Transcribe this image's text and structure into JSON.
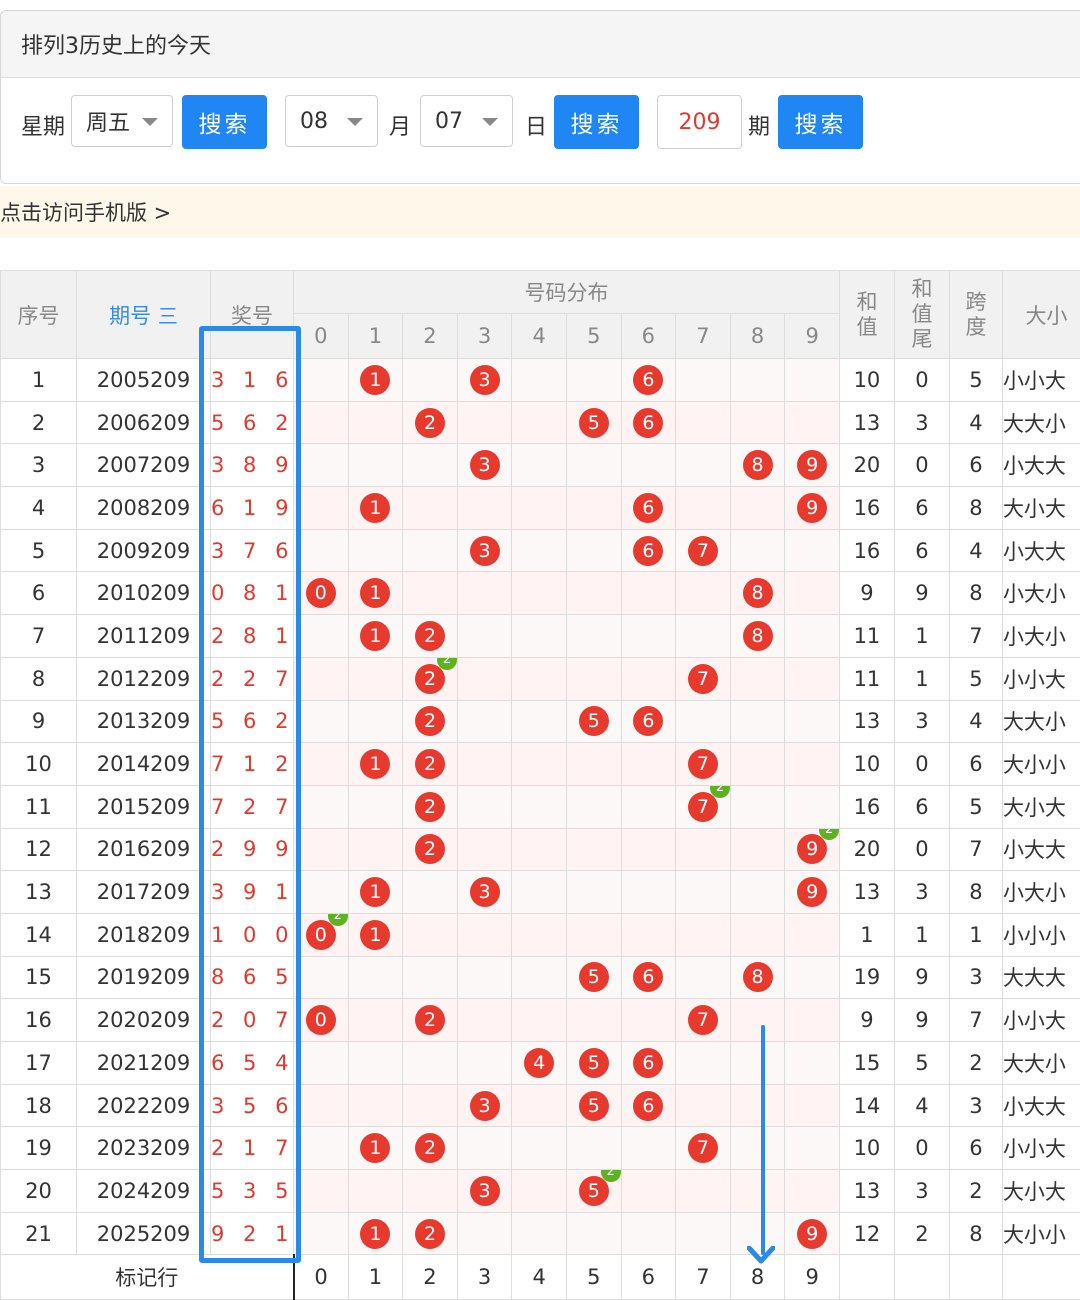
{
  "panel": {
    "title": "排列3历史上的今天",
    "weekday_label": "星期",
    "weekday_value": "周五",
    "search_label": "搜索",
    "month_value": "08",
    "month_label": "月",
    "day_value": "07",
    "day_label": "日",
    "period_value": "209",
    "period_label": "期"
  },
  "mobile_link": "点击访问手机版 >",
  "table": {
    "headers": {
      "index": "序号",
      "period": "期号",
      "period_sort_icon": "三",
      "prize": "奖号",
      "distribution": "号码分布",
      "sum": "和值",
      "sum_tail": "和值尾",
      "span": "跨度",
      "size": "大小"
    },
    "digit_headers": [
      "0",
      "1",
      "2",
      "3",
      "4",
      "5",
      "6",
      "7",
      "8",
      "9"
    ],
    "rows": [
      {
        "idx": "1",
        "period": "2005209",
        "prize": "3 1 6",
        "balls": [
          1,
          3,
          6
        ],
        "rep": null,
        "sum": "10",
        "tail": "0",
        "span": "5",
        "size": "小小大"
      },
      {
        "idx": "2",
        "period": "2006209",
        "prize": "5 6 2",
        "balls": [
          2,
          5,
          6
        ],
        "rep": null,
        "sum": "13",
        "tail": "3",
        "span": "4",
        "size": "大大小"
      },
      {
        "idx": "3",
        "period": "2007209",
        "prize": "3 8 9",
        "balls": [
          3,
          8,
          9
        ],
        "rep": null,
        "sum": "20",
        "tail": "0",
        "span": "6",
        "size": "小大大"
      },
      {
        "idx": "4",
        "period": "2008209",
        "prize": "6 1 9",
        "balls": [
          1,
          6,
          9
        ],
        "rep": null,
        "sum": "16",
        "tail": "6",
        "span": "8",
        "size": "大小大"
      },
      {
        "idx": "5",
        "period": "2009209",
        "prize": "3 7 6",
        "balls": [
          3,
          6,
          7
        ],
        "rep": null,
        "sum": "16",
        "tail": "6",
        "span": "4",
        "size": "小大大"
      },
      {
        "idx": "6",
        "period": "2010209",
        "prize": "0 8 1",
        "balls": [
          0,
          1,
          8
        ],
        "rep": null,
        "sum": "9",
        "tail": "9",
        "span": "8",
        "size": "小大小"
      },
      {
        "idx": "7",
        "period": "2011209",
        "prize": "2 8 1",
        "balls": [
          1,
          2,
          8
        ],
        "rep": null,
        "sum": "11",
        "tail": "1",
        "span": "7",
        "size": "小大小"
      },
      {
        "idx": "8",
        "period": "2012209",
        "prize": "2 2 7",
        "balls": [
          2,
          7
        ],
        "rep": 2,
        "sum": "11",
        "tail": "1",
        "span": "5",
        "size": "小小大"
      },
      {
        "idx": "9",
        "period": "2013209",
        "prize": "5 6 2",
        "balls": [
          2,
          5,
          6
        ],
        "rep": null,
        "sum": "13",
        "tail": "3",
        "span": "4",
        "size": "大大小"
      },
      {
        "idx": "10",
        "period": "2014209",
        "prize": "7 1 2",
        "balls": [
          1,
          2,
          7
        ],
        "rep": null,
        "sum": "10",
        "tail": "0",
        "span": "6",
        "size": "大小小"
      },
      {
        "idx": "11",
        "period": "2015209",
        "prize": "7 2 7",
        "balls": [
          2,
          7
        ],
        "rep": 7,
        "sum": "16",
        "tail": "6",
        "span": "5",
        "size": "大小大"
      },
      {
        "idx": "12",
        "period": "2016209",
        "prize": "2 9 9",
        "balls": [
          2,
          9
        ],
        "rep": 9,
        "sum": "20",
        "tail": "0",
        "span": "7",
        "size": "小大大"
      },
      {
        "idx": "13",
        "period": "2017209",
        "prize": "3 9 1",
        "balls": [
          1,
          3,
          9
        ],
        "rep": null,
        "sum": "13",
        "tail": "3",
        "span": "8",
        "size": "小大小"
      },
      {
        "idx": "14",
        "period": "2018209",
        "prize": "1 0 0",
        "balls": [
          0,
          1
        ],
        "rep": 0,
        "sum": "1",
        "tail": "1",
        "span": "1",
        "size": "小小小"
      },
      {
        "idx": "15",
        "period": "2019209",
        "prize": "8 6 5",
        "balls": [
          5,
          6,
          8
        ],
        "rep": null,
        "sum": "19",
        "tail": "9",
        "span": "3",
        "size": "大大大"
      },
      {
        "idx": "16",
        "period": "2020209",
        "prize": "2 0 7",
        "balls": [
          0,
          2,
          7
        ],
        "rep": null,
        "sum": "9",
        "tail": "9",
        "span": "7",
        "size": "小小大"
      },
      {
        "idx": "17",
        "period": "2021209",
        "prize": "6 5 4",
        "balls": [
          4,
          5,
          6
        ],
        "rep": null,
        "sum": "15",
        "tail": "5",
        "span": "2",
        "size": "大大小"
      },
      {
        "idx": "18",
        "period": "2022209",
        "prize": "3 5 6",
        "balls": [
          3,
          5,
          6
        ],
        "rep": null,
        "sum": "14",
        "tail": "4",
        "span": "3",
        "size": "小大大"
      },
      {
        "idx": "19",
        "period": "2023209",
        "prize": "2 1 7",
        "balls": [
          1,
          2,
          7
        ],
        "rep": null,
        "sum": "10",
        "tail": "0",
        "span": "6",
        "size": "小小大"
      },
      {
        "idx": "20",
        "period": "2024209",
        "prize": "5 3 5",
        "balls": [
          3,
          5
        ],
        "rep": 5,
        "sum": "13",
        "tail": "3",
        "span": "2",
        "size": "大小大"
      },
      {
        "idx": "21",
        "period": "2025209",
        "prize": "9 2 1",
        "balls": [
          1,
          2,
          9
        ],
        "rep": null,
        "sum": "12",
        "tail": "2",
        "span": "8",
        "size": "大小小"
      }
    ],
    "repeat_badge": "2",
    "mark_row_label": "标记行",
    "mark_row_digits": [
      "0",
      "1",
      "2",
      "3",
      "4",
      "5",
      "6",
      "7",
      "8",
      "9"
    ]
  },
  "colors": {
    "accent": "#1f86f3",
    "ball": "#e73a2f",
    "repeat_badge": "#5cb320",
    "annotation": "#2a8ae6"
  }
}
